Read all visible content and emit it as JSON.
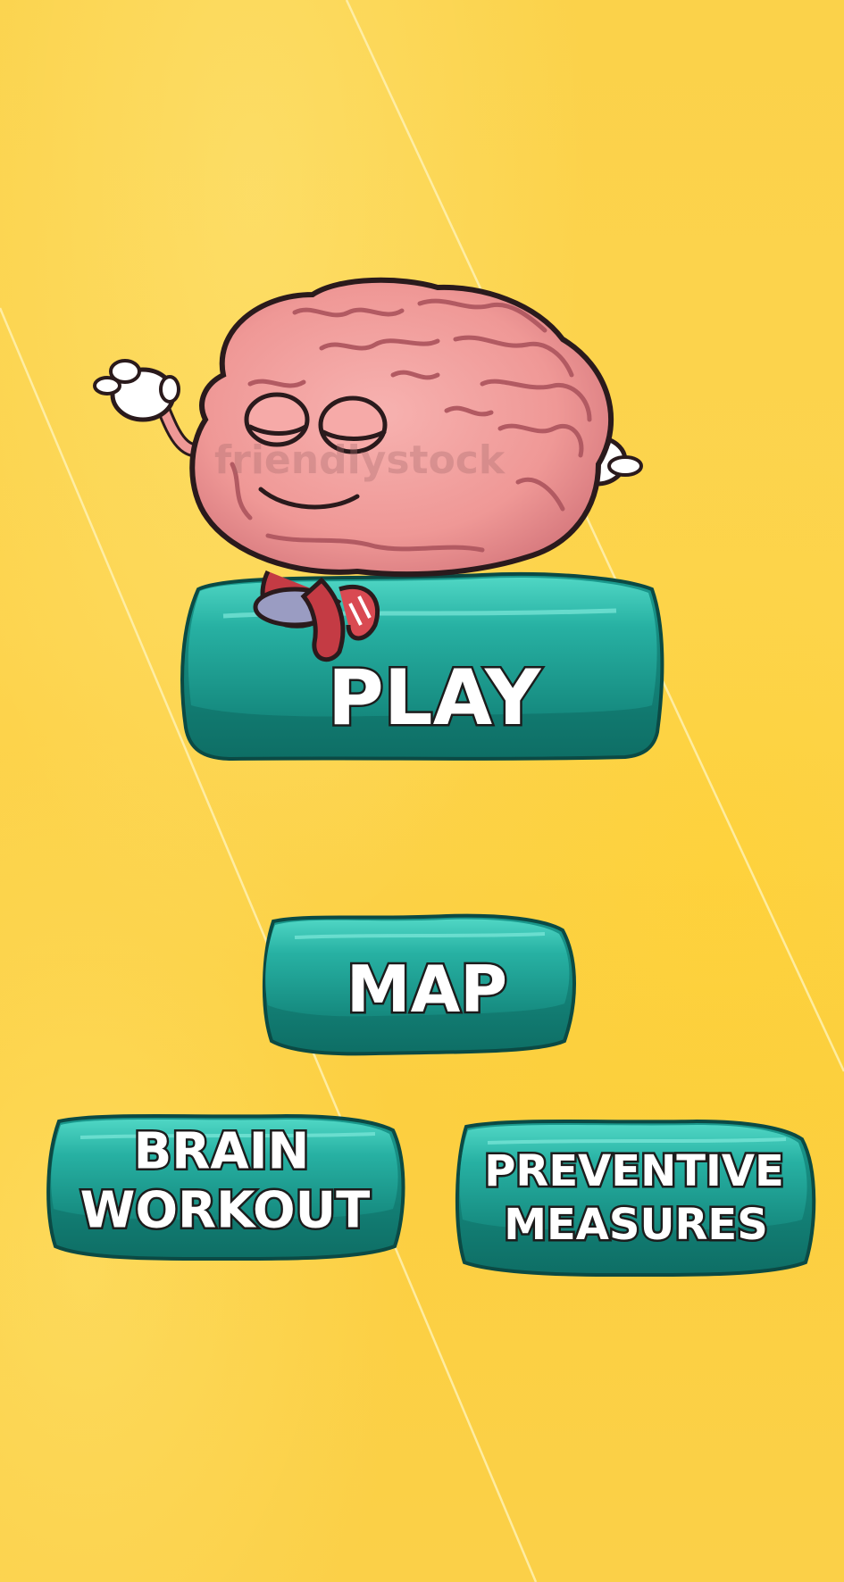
{
  "buttons": {
    "play": "PLAY",
    "map": "MAP",
    "brain_workout": [
      "BRAIN",
      "WORKOUT"
    ],
    "preventive_measures": [
      "PREVENTIVE",
      "MEASURES"
    ]
  },
  "mascot": {
    "watermark": "friendlystock"
  },
  "colors": {
    "background": "#fcd248",
    "button_fill": "#21a89a",
    "button_light": "#3dc9b8",
    "button_dark": "#117c72",
    "brain_pink": "#f29a9a",
    "brain_dark": "#c96f74",
    "outline": "#2a1a1c"
  }
}
